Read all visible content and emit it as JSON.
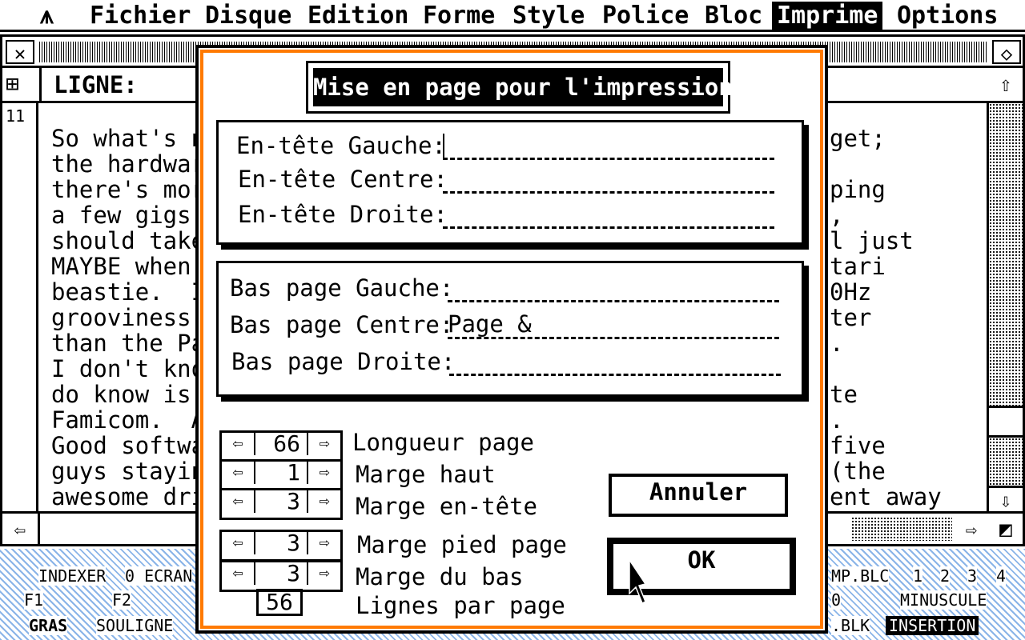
{
  "menubar": {
    "logo": "⩚",
    "items": [
      "Fichier",
      "Disque",
      "Edition",
      "Forme",
      "Style",
      "Police",
      "Bloc",
      "Imprime",
      "Options"
    ],
    "active": "Imprime"
  },
  "doc": {
    "header_label": "LIGNE:",
    "line_number": "11",
    "lines_left": [
      "So what's n",
      "the hardwar",
      "there's mor",
      "a few gigs",
      "should take",
      "MAYBE when",
      "beastie.  I",
      "grooviness",
      "than the Pa",
      "I don't kno",
      "do know is",
      "Famicom.  A",
      "Good softwa",
      "guys stayin",
      "awesome dri"
    ],
    "lines_right": [
      "get;",
      "",
      "ping",
      ",",
      "l just",
      "tari",
      "0Hz",
      "ter",
      ".",
      "",
      "te",
      ".",
      "five",
      "(the",
      "ent away"
    ]
  },
  "statusbar": {
    "row1_left": [
      "INDEXER",
      "0 ECRAN"
    ],
    "row2_left": [
      "F1",
      "F2"
    ],
    "row3_left": [
      "GRAS",
      "SOULIGNE"
    ],
    "row1_right": [
      "MP.BLC",
      "1",
      "2",
      "3",
      "4"
    ],
    "row2_right": [
      "0",
      "MINUSCULE"
    ],
    "row3_right": [
      ".BLK",
      "INSERTION"
    ]
  },
  "dialog": {
    "title": "Mise en page pour l'impression",
    "header_fields": [
      {
        "label": "En-tête Gauche:",
        "value": ""
      },
      {
        "label": "En-tête Centre:",
        "value": ""
      },
      {
        "label": "En-tête Droite:",
        "value": ""
      }
    ],
    "footer_fields": [
      {
        "label": "Bas page Gauche:",
        "value": ""
      },
      {
        "label": "Bas page Centre:",
        "value": "Page &"
      },
      {
        "label": "Bas page Droite:",
        "value": ""
      }
    ],
    "spinners": [
      {
        "label": "Longueur page",
        "value": "66"
      },
      {
        "label": "Marge haut",
        "value": "1"
      },
      {
        "label": "Marge en-tête",
        "value": "3"
      },
      {
        "label": "Marge pied page",
        "value": "3"
      },
      {
        "label": "Marge du bas",
        "value": "3"
      }
    ],
    "lines_per_page": {
      "label": "Lignes par page",
      "value": "56"
    },
    "cancel_label": "Annuler",
    "ok_label": "OK"
  },
  "colors": {
    "dialog_accent": "#ff7a00",
    "status_hatch": "#8ab4e8"
  }
}
